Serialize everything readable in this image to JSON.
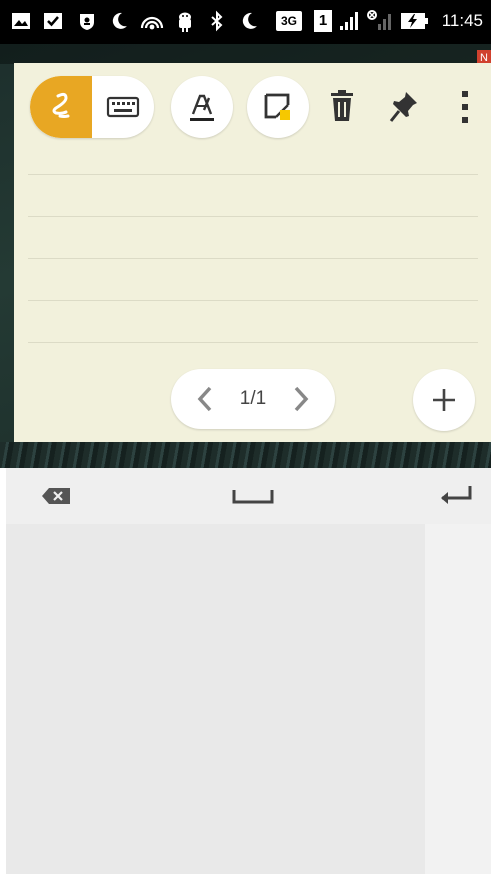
{
  "status_bar": {
    "time": "11:45",
    "network_badge": "3G",
    "sim_badge": "1",
    "icons": [
      "image-icon",
      "checkbox-icon",
      "shield-icon",
      "moon-icon",
      "wifi-hotspot-icon",
      "android-icon",
      "bluetooth-icon",
      "moon-icon",
      "network-3g-icon",
      "sim-1-icon",
      "signal-icon",
      "signal-no-sim-icon",
      "battery-charging-icon"
    ]
  },
  "background": {
    "notification_badge": "N"
  },
  "note": {
    "toolbar": {
      "mode_toggle": {
        "active": "handwriting",
        "options": [
          "handwriting-icon",
          "keyboard-icon"
        ]
      },
      "buttons": [
        "pen-settings-icon",
        "note-color-icon",
        "trash-icon",
        "pin-icon",
        "more-vert-icon"
      ],
      "colors": {
        "accent": "#e8a723",
        "note_bg": "#f2f1dc",
        "color_swatch": "#f6c800"
      }
    },
    "ruled_lines": 5,
    "pager": {
      "label": "1/1"
    },
    "add_page_icon": "plus-icon"
  },
  "keyboard": {
    "keys": [
      "backspace-icon",
      "space-icon",
      "enter-icon"
    ],
    "handwriting_area": "empty"
  }
}
